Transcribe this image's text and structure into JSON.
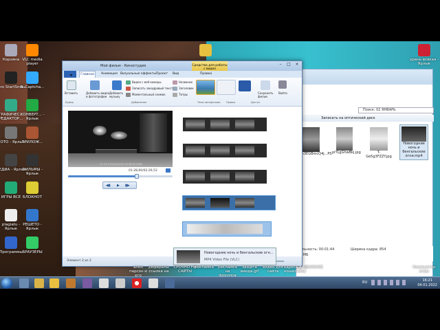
{
  "desktop": {
    "icons_left": [
      {
        "label": "Корзина",
        "color": "#aab"
      },
      {
        "label": "Nero StartSma...",
        "color": "#222"
      },
      {
        "label": "ГРАФИЧЕС... РЕДАКТОР...",
        "color": "#3a8"
      },
      {
        "label": "ФОТО - Ярлык",
        "color": "#777"
      },
      {
        "label": "МЕДИА - Ярлык",
        "color": "#444"
      },
      {
        "label": "ИГРЫ ВСЕ",
        "color": "#2a7"
      },
      {
        "label": "plagiatu - Ярлык",
        "color": "#eee"
      },
      {
        "label": "Программы",
        "color": "#36c"
      }
    ],
    "icons_col2": [
      {
        "label": "VLC media player",
        "color": "#f80"
      },
      {
        "label": "RuCaptcha...",
        "color": "#3af"
      },
      {
        "label": "КОНВЕРТ... - Ярлык",
        "color": "#2a4"
      },
      {
        "label": "ПРИЛОЖ...",
        "color": "#a53"
      },
      {
        "label": "ФИЛЬМЫ - Ярлык",
        "color": "#333"
      },
      {
        "label": "БЛОКНОТ",
        "color": "#dc3"
      },
      {
        "label": "РЕШЕТО - Ярлык",
        "color": "#37c"
      },
      {
        "label": "БРАУЗЕРЫ",
        "color": "#3c6"
      }
    ],
    "right_icon": {
      "label": "хрень всякая - Ярлык"
    },
    "bottom_icons": [
      {
        "label": "алон парсон и его"
      },
      {
        "label": "рефералы ссылка на"
      },
      {
        "label": "СРОЧНО НА САЙТЫ"
      },
      {
        "label": "рекламка"
      },
      {
        "label": "рекламка на форумов"
      },
      {
        "label": "защита винда.gif"
      },
      {
        "label": "видео для сайта"
      },
      {
        "label": "адреса для кошельков"
      },
      {
        "label": "ВАЖНОЕ"
      },
      {
        "label": "Компьютер игры"
      }
    ]
  },
  "movie_maker": {
    "title": "Мой фильм - Киностудия",
    "context_tab": "Средства для работы с видео",
    "context_sub": "Правка",
    "file_button": "▾",
    "tabs": [
      "Главная",
      "Анимация",
      "Визуальные эффекты",
      "Проект",
      "Вид"
    ],
    "ribbon": {
      "paste": "Вставить",
      "add_video": "Добавить видео и фотографии",
      "add_music": "Добавить музыку",
      "webcam": "Видео с веб-камеры",
      "narration": "Записать закадровый текст",
      "snapshot": "Моментальный снимок",
      "title": "Название",
      "caption": "Заголовок",
      "credits": "Титры",
      "themes_group": "Темы автофильма",
      "edit_group": "Правка",
      "save_movie": "Сохранить фильм",
      "signin": "Войти",
      "group_clipboard": "Буфер",
      "group_add": "Добавление",
      "group_share": "Доступ"
    },
    "timecode": "01:28,60/02:26,53",
    "seek_fraction": 0.66,
    "play_controls": [
      "◀▮",
      "▶",
      "▮▶"
    ],
    "status": "Элемент 2 из 2",
    "video_overlay": "12 CH 0 2022/01/01 00:38:55 0000"
  },
  "explorer": {
    "address": "Поиск: 02 ЯНВАРЬ",
    "toolbar": "Записать на оптический диск",
    "thumbnails": [
      {
        "label": "m3EGBmcQ4j...PS"
      },
      {
        "label": "piYLgGhwBkj.jpg"
      },
      {
        "label": "T-Ge5g3FZZY.jpg"
      },
      {
        "label": "Новогодние ночь и бенгальские огни.mp4"
      }
    ],
    "info": {
      "duration_label": "Продолжительность: 00:01:44",
      "size_label": "Размер: 81,3 МБ",
      "width_label": "Ширина кадра: 854"
    }
  },
  "taskbar_peek": {
    "line1": "Новогодние ночь и бенгальские огн...",
    "line2": "MP4 Video File (VLC)"
  },
  "taskbar": {
    "lang": "RU",
    "time": "16:21",
    "date": "04.01.2022"
  }
}
